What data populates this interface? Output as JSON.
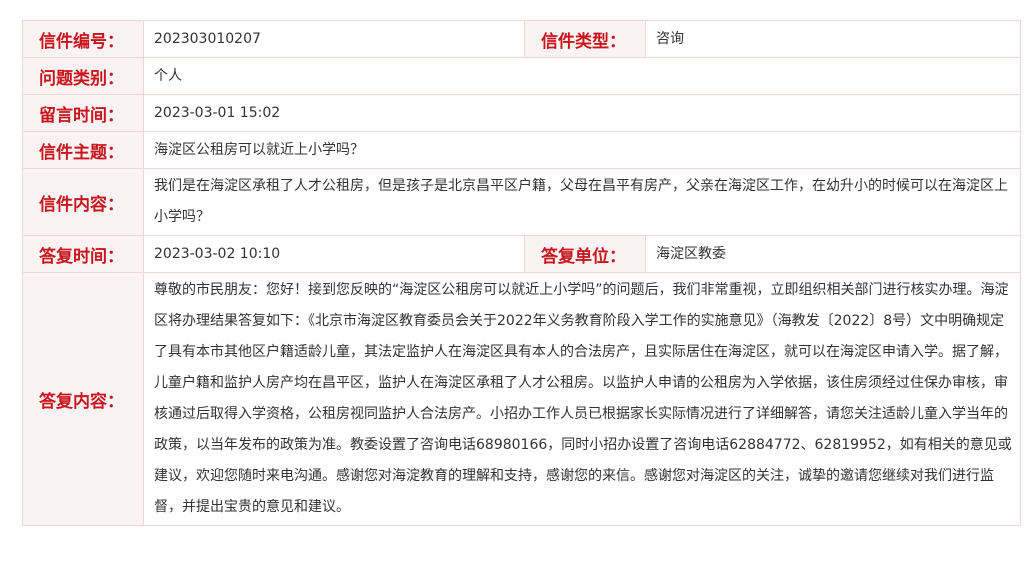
{
  "letter": {
    "id_label": "信件编号：",
    "id_value": "202303010207",
    "type_label": "信件类型：",
    "type_value": "咨询",
    "category_label": "问题类别：",
    "category_value": "个人",
    "msg_time_label": "留言时间：",
    "msg_time_value": "2023-03-01 15:02",
    "subject_label": "信件主题：",
    "subject_value": "海淀区公租房可以就近上小学吗？",
    "content_label": "信件内容：",
    "content_value": "我们是在海淀区承租了人才公租房，但是孩子是北京昌平区户籍，父母在昌平有房产，父亲在海淀区工作，在幼升小的时候可以在海淀区上小学吗？",
    "reply_time_label": "答复时间：",
    "reply_time_value": "2023-03-02 10:10",
    "reply_unit_label": "答复单位：",
    "reply_unit_value": "海淀区教委",
    "reply_content_label": "答复内容：",
    "reply_content_value": "尊敬的市民朋友：您好！接到您反映的“海淀区公租房可以就近上小学吗”的问题后，我们非常重视，立即组织相关部门进行核实办理。海淀区将办理结果答复如下：《北京市海淀区教育委员会关于2022年义务教育阶段入学工作的实施意见》（海教发〔2022〕8号）文中明确规定了具有本市其他区户籍适龄儿童，其法定监护人在海淀区具有本人的合法房产，且实际居住在海淀区，就可以在海淀区申请入学。据了解，儿童户籍和监护人房产均在昌平区，监护人在海淀区承租了人才公租房。以监护人申请的公租房为入学依据，该住房须经过住保办审核，审核通过后取得入学资格，公租房视同监护人合法房产。小招办工作人员已根据家长实际情况进行了详细解答，请您关注适龄儿童入学当年的政策，以当年发布的政策为准。教委设置了咨询电话68980166，同时小招办设置了咨询电话62884772、62819952，如有相关的意见或建议，欢迎您随时来电沟通。感谢您对海淀教育的理解和支持，感谢您的来信。感谢您对海淀区的关注，诚挚的邀请您继续对我们进行监督，并提出宝贵的意见和建议。"
  }
}
